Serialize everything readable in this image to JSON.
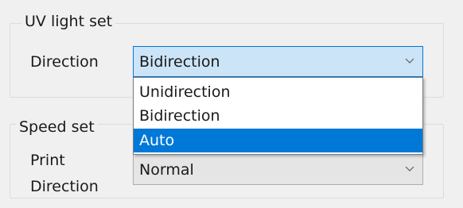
{
  "uv_group": {
    "title": "UV light set",
    "direction_label": "Direction",
    "direction_value": "Bidirection",
    "options": [
      "Unidirection",
      "Bidirection",
      "Auto"
    ],
    "highlighted_option": "Auto"
  },
  "speed_group": {
    "title": "Speed set",
    "print_label_line1": "Print",
    "print_label_line2": "Direction",
    "print_value": "Normal"
  },
  "colors": {
    "panel_background": "#f0f0f0",
    "focused_combo_background": "#cce4f7",
    "focus_border": "#0078d7",
    "highlight": "#0078d7",
    "disabled_combo_background": "#e5e5e5"
  },
  "icons": {
    "combo_arrow": "chevron-down-icon"
  }
}
